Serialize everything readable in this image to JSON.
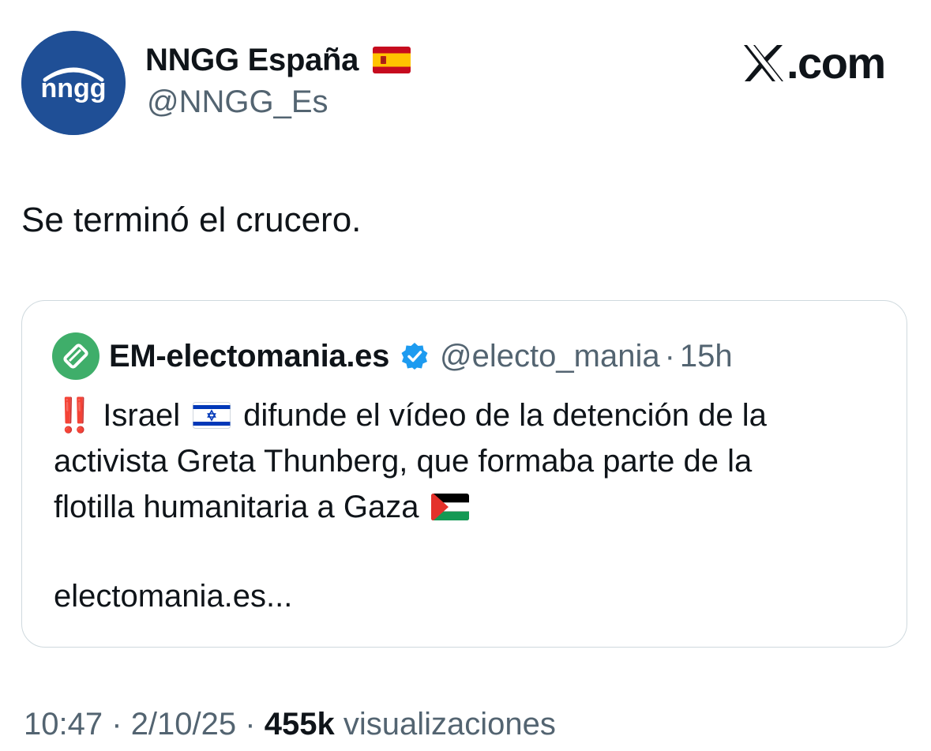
{
  "author": {
    "display_name": "NNGG España",
    "handle": "@NNGG_Es",
    "avatar_text": "nngg",
    "flag_emoji": "spain-flag"
  },
  "brand": {
    "text": ".com",
    "logo_icon": "x-logo-icon"
  },
  "tweet": {
    "text": "Se terminó el crucero."
  },
  "quoted_tweet": {
    "display_name": "EM-electomania.es",
    "verified": true,
    "handle": "@electo_mania",
    "separator": "·",
    "time": "15h",
    "emoji_prefix": "‼️",
    "line1_a": "Israel",
    "line1_b": "difunde el vídeo de la detención de la",
    "line2": "activista Greta Thunberg, que formaba parte de la",
    "line3": "flotilla humanitaria a Gaza",
    "link_text": "electomania.es..."
  },
  "meta": {
    "time": "10:47",
    "sep1": "·",
    "date": "2/10/25",
    "sep2": "·",
    "views_count": "455k",
    "views_label": "visualizaciones"
  },
  "colors": {
    "avatar_bg": "#1f4f96",
    "secondary_text": "#536471",
    "verified_blue": "#1d9bf0",
    "quote_avatar_green": "#3fae6a",
    "border": "#cfd9de"
  }
}
